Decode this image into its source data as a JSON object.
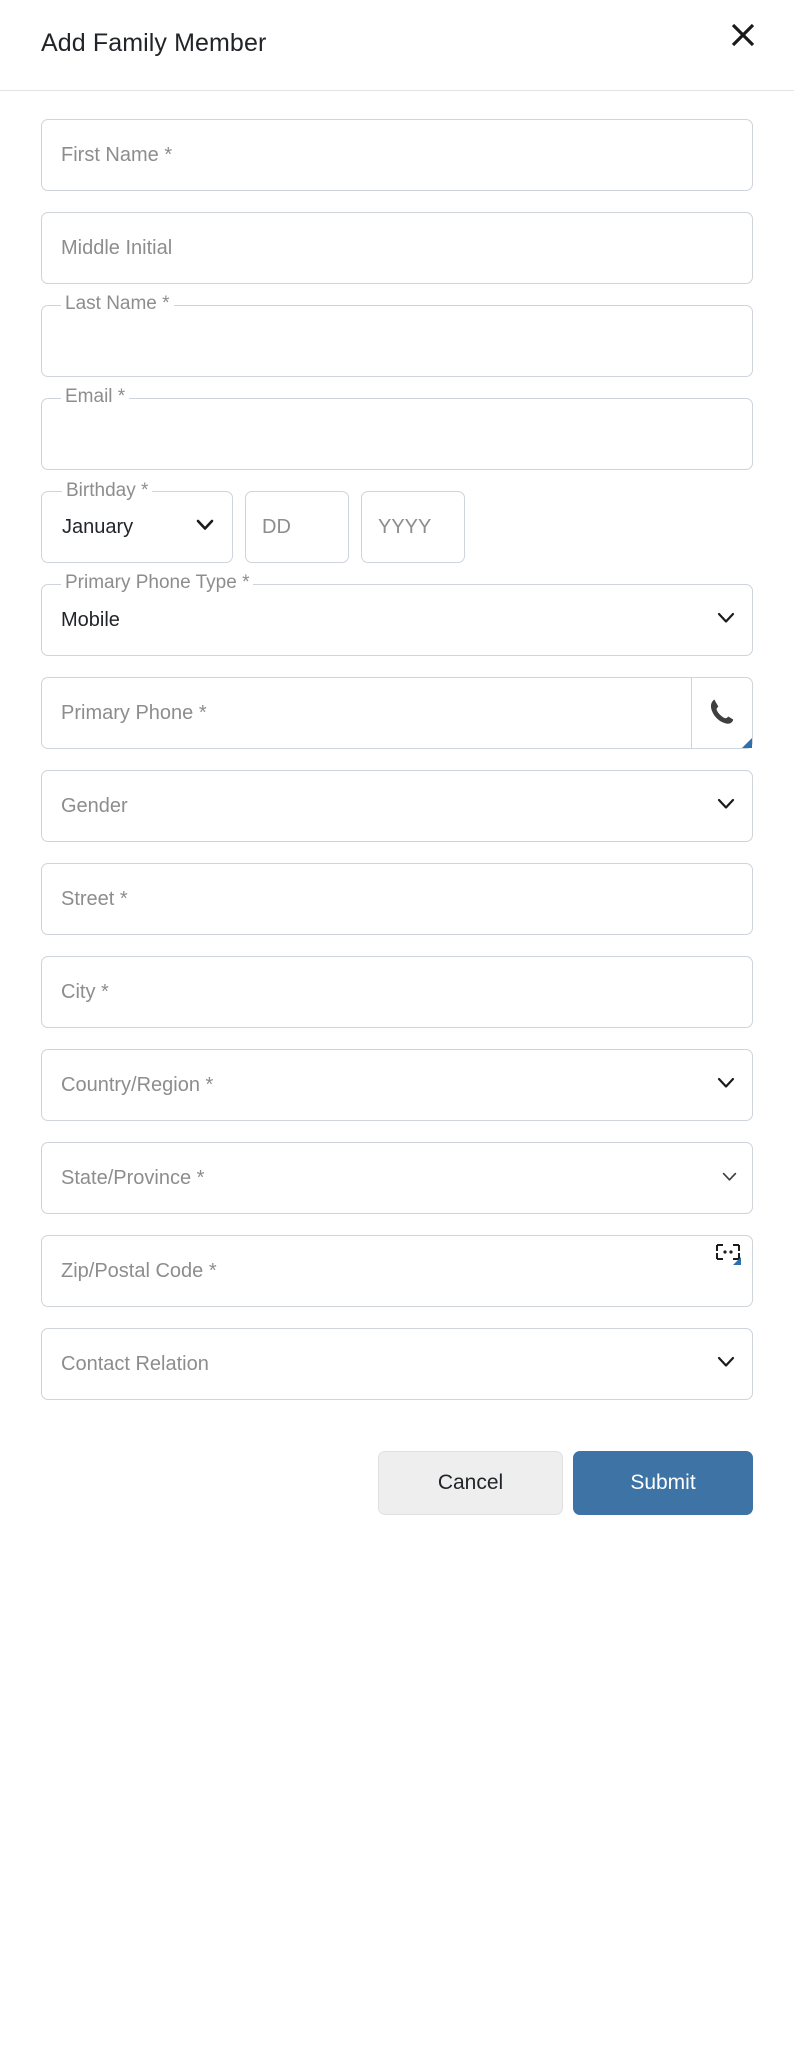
{
  "modal": {
    "title": "Add Family Member",
    "close_icon": "close-icon"
  },
  "fields": {
    "first_name": {
      "placeholder": "First Name *",
      "value": ""
    },
    "middle_initial": {
      "placeholder": "Middle Initial",
      "value": ""
    },
    "last_name": {
      "label": "Last Name *",
      "value": ""
    },
    "email": {
      "label": "Email *",
      "value": ""
    },
    "birthday": {
      "label": "Birthday *",
      "month_value": "January",
      "day_placeholder": "DD",
      "day_value": "",
      "year_placeholder": "YYYY",
      "year_value": ""
    },
    "primary_phone_type": {
      "label": "Primary Phone Type *",
      "value": "Mobile"
    },
    "primary_phone": {
      "placeholder": "Primary Phone *",
      "value": "",
      "addon_icon": "phone-icon"
    },
    "gender": {
      "placeholder": "Gender",
      "value": ""
    },
    "street": {
      "placeholder": "Street *",
      "value": ""
    },
    "city": {
      "placeholder": "City *",
      "value": ""
    },
    "country_region": {
      "placeholder": "Country/Region *",
      "value": ""
    },
    "state_province": {
      "placeholder": "State/Province *",
      "value": ""
    },
    "zip_postal_code": {
      "placeholder": "Zip/Postal Code *",
      "value": "",
      "addon_icon": "zip-lookup-icon"
    },
    "contact_relation": {
      "placeholder": "Contact Relation",
      "value": ""
    }
  },
  "footer": {
    "cancel_label": "Cancel",
    "submit_label": "Submit"
  },
  "colors": {
    "submit_bg": "#3d74a5",
    "cancel_bg": "#eeeeee",
    "border": "#ced4da",
    "placeholder_text": "#8d8d8d",
    "title_text": "#212529"
  }
}
